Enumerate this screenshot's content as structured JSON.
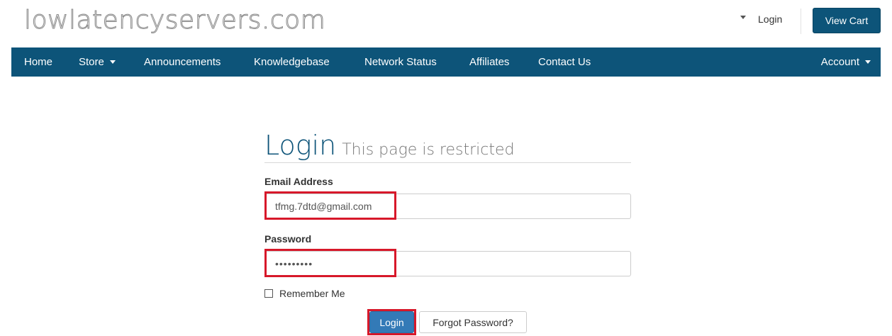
{
  "header": {
    "logo": "lowlatencyservers.com",
    "login_label": "Login",
    "view_cart_label": "View Cart"
  },
  "nav": {
    "items": [
      {
        "label": "Home"
      },
      {
        "label": "Store"
      },
      {
        "label": "Announcements"
      },
      {
        "label": "Knowledgebase"
      },
      {
        "label": "Network Status"
      },
      {
        "label": "Affiliates"
      },
      {
        "label": "Contact Us"
      }
    ],
    "account_label": "Account"
  },
  "login": {
    "title": "Login",
    "subtitle": "This page is restricted",
    "email_label": "Email Address",
    "email_value": "tfmg.7dtd@gmail.com",
    "password_label": "Password",
    "password_value": "•••••••••",
    "remember_label": "Remember Me",
    "submit_label": "Login",
    "forgot_label": "Forgot Password?"
  },
  "colors": {
    "brand": "#0d5479",
    "primary_button": "#337ab7",
    "highlight": "#d7182a"
  }
}
